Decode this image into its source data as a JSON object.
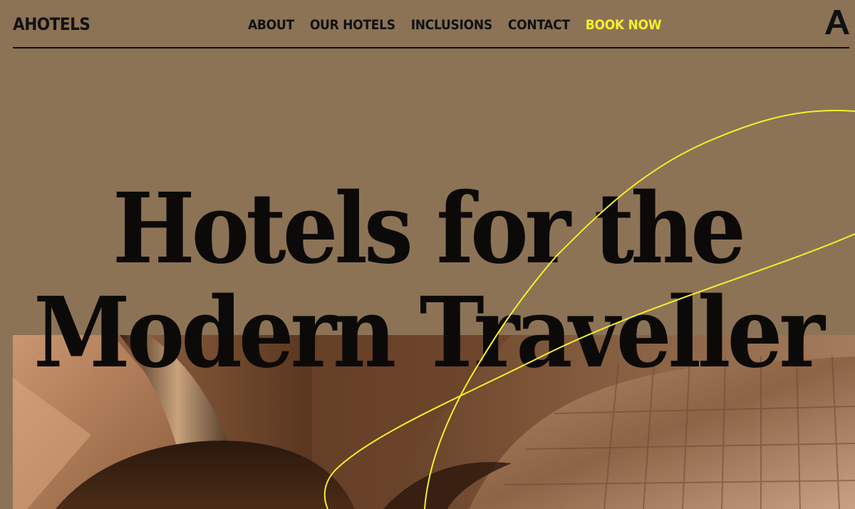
{
  "header": {
    "brand": "AHOTELS",
    "nav": {
      "about": "ABOUT",
      "our_hotels": "OUR HOTELS",
      "inclusions": "INCLUSIONS",
      "contact": "CONTACT",
      "book_now": "BOOK NOW"
    },
    "logo_icon": "a-monogram-icon"
  },
  "hero": {
    "headline_line1": "Hotels for the",
    "headline_line2": "Modern Traveller",
    "image_icon": "architectural-interior-photo"
  },
  "colors": {
    "background": "#8c7356",
    "text": "#0c0a08",
    "accent": "#f4ef2c"
  }
}
